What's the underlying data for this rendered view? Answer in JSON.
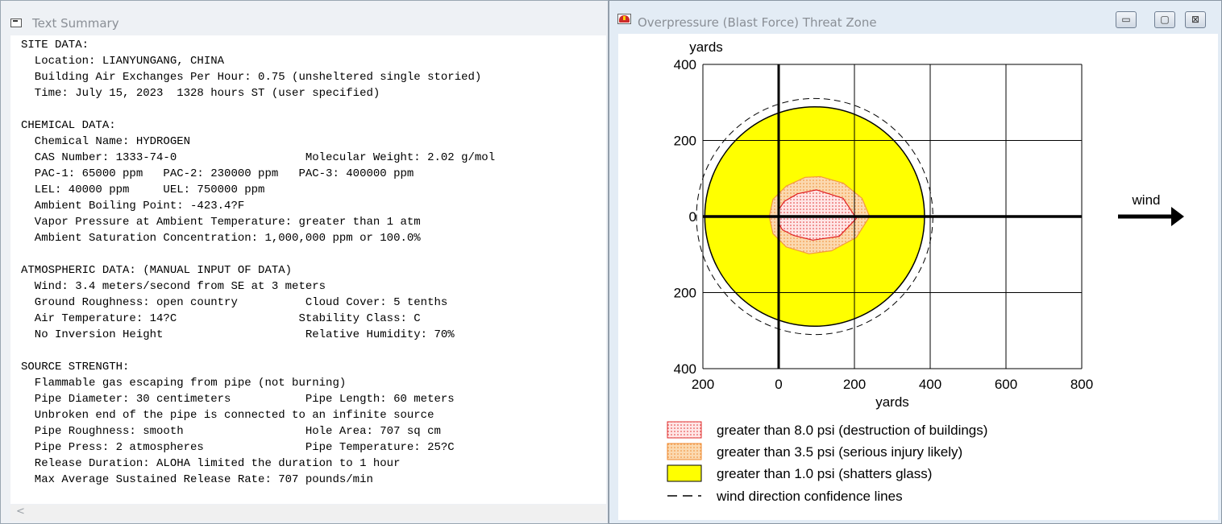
{
  "text_window": {
    "title": "Text Summary",
    "lines": [
      "SITE DATA:",
      "  Location: LIANYUNGANG, CHINA",
      "  Building Air Exchanges Per Hour: 0.75 (unsheltered single storied)",
      "  Time: July 15, 2023  1328 hours ST (user specified)",
      "",
      "CHEMICAL DATA:",
      "  Chemical Name: HYDROGEN",
      "  CAS Number: 1333-74-0                   Molecular Weight: 2.02 g/mol",
      "  PAC-1: 65000 ppm   PAC-2: 230000 ppm   PAC-3: 400000 ppm",
      "  LEL: 40000 ppm     UEL: 750000 ppm",
      "  Ambient Boiling Point: -423.4?F",
      "  Vapor Pressure at Ambient Temperature: greater than 1 atm",
      "  Ambient Saturation Concentration: 1,000,000 ppm or 100.0%",
      "",
      "ATMOSPHERIC DATA: (MANUAL INPUT OF DATA)",
      "  Wind: 3.4 meters/second from SE at 3 meters",
      "  Ground Roughness: open country          Cloud Cover: 5 tenths",
      "  Air Temperature: 14?C                  Stability Class: C",
      "  No Inversion Height                     Relative Humidity: 70%",
      "",
      "SOURCE STRENGTH:",
      "  Flammable gas escaping from pipe (not burning)",
      "  Pipe Diameter: 30 centimeters           Pipe Length: 60 meters",
      "  Unbroken end of the pipe is connected to an infinite source",
      "  Pipe Roughness: smooth                  Hole Area: 707 sq cm",
      "  Pipe Press: 2 atmospheres               Pipe Temperature: 25?C",
      "  Release Duration: ALOHA limited the duration to 1 hour",
      "  Max Average Sustained Release Rate: 707 pounds/min"
    ],
    "scroll_left_glyph": "<"
  },
  "threat_window": {
    "title": "Overpressure (Blast Force) Threat Zone",
    "controls": {
      "minimize": "▭",
      "maximize": "▢",
      "close": "⊠"
    }
  },
  "chart_data": {
    "type": "threat-zone",
    "x_label": "yards",
    "y_label": "yards",
    "x_ticks": [
      "200",
      "0",
      "200",
      "400",
      "600",
      "800"
    ],
    "y_ticks": [
      "400",
      "200",
      "0",
      "200",
      "400"
    ],
    "xlim": [
      -200,
      800
    ],
    "ylim": [
      -400,
      400
    ],
    "wind_label": "wind",
    "zones": [
      {
        "label": "greater than 8.0 psi (destruction of buildings)",
        "fill": "#ffdede",
        "stroke": "#e02020",
        "pattern": "dots-red",
        "outline": [
          [
            -2,
            15
          ],
          [
            -2,
            -15
          ],
          [
            10,
            -35
          ],
          [
            40,
            -50
          ],
          [
            90,
            -62
          ],
          [
            160,
            -52
          ],
          [
            205,
            -5
          ],
          [
            170,
            48
          ],
          [
            100,
            70
          ],
          [
            50,
            60
          ],
          [
            15,
            40
          ]
        ]
      },
      {
        "label": "greater than 3.5 psi (serious injury likely)",
        "fill": "#f9d4a6",
        "stroke": "#f49a3c",
        "pattern": "dots-orange",
        "outline": [
          [
            -25,
            0
          ],
          [
            -15,
            -45
          ],
          [
            20,
            -80
          ],
          [
            80,
            -98
          ],
          [
            140,
            -90
          ],
          [
            205,
            -55
          ],
          [
            240,
            0
          ],
          [
            220,
            48
          ],
          [
            170,
            88
          ],
          [
            110,
            105
          ],
          [
            70,
            103
          ],
          [
            20,
            80
          ],
          [
            -15,
            45
          ]
        ]
      },
      {
        "label": "greater than 1.0 psi (shatters glass)",
        "fill": "#ffff00",
        "stroke": "#000000",
        "pattern": "solid",
        "circle": {
          "cx": 95,
          "cy": 0,
          "r": 290
        }
      }
    ],
    "confidence_line": {
      "label": "wind direction confidence lines",
      "circle": {
        "cx": 95,
        "cy": 0,
        "r": 312
      }
    }
  }
}
